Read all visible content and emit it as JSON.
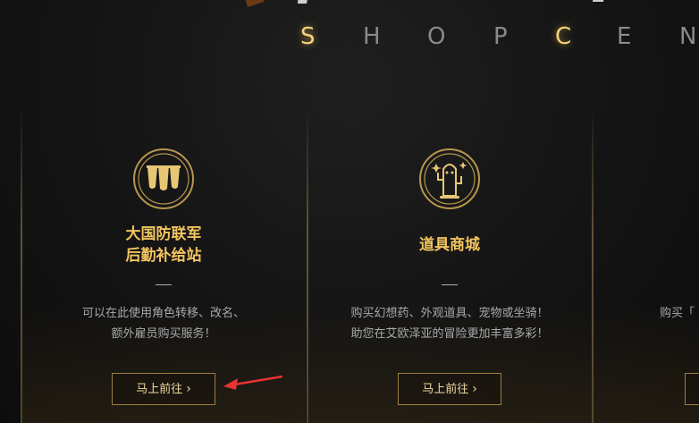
{
  "banner": {
    "shop_letters": [
      "S",
      "H",
      "O",
      "P",
      "C",
      "E",
      "N"
    ],
    "highlight_color": "#f3d27a"
  },
  "cards": [
    {
      "title_line1": "大国防联军",
      "title_line2": "后勤补给站",
      "desc_line1": "可以在此使用角色转移、改名、",
      "desc_line2": "额外雇员购买服务！",
      "button_label": "马上前往",
      "icon": "cups-icon"
    },
    {
      "title_line1": "道具商城",
      "desc_line1": "购买幻想药、外观道具、宠物或坐骑！",
      "desc_line2": "助您在艾欧泽亚的冒险更加丰富多彩！",
      "button_label": "马上前往",
      "icon": "cactuar-icon"
    },
    {
      "desc_line1": "购买「"
    }
  ],
  "accent_color": "#f2c460",
  "annotation_color": "#e53333"
}
